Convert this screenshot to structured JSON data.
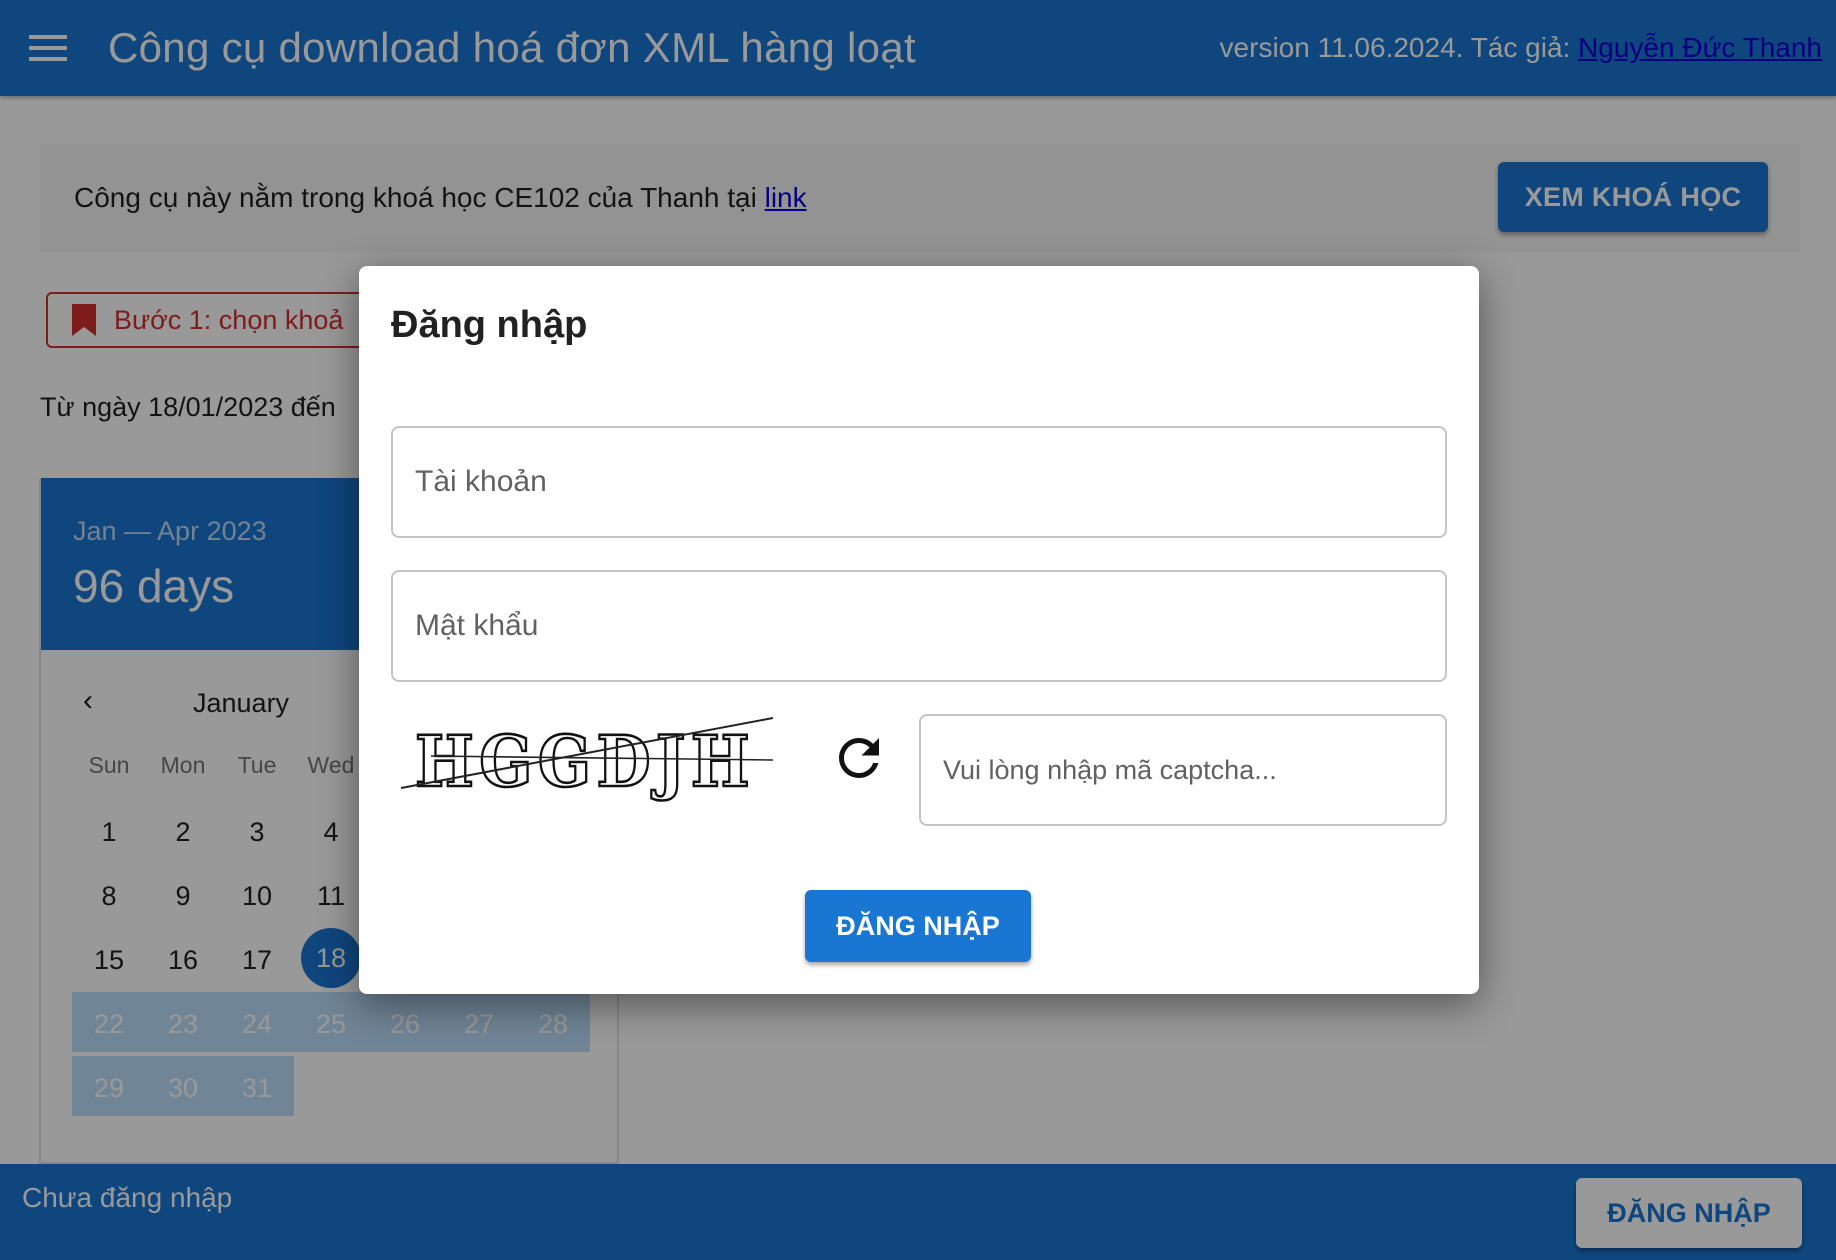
{
  "appbar": {
    "title": "Công cụ download hoá đơn XML hàng loạt",
    "version_text": "version 11.06.2024. Tác giả: ",
    "author": "Nguyễn Đức Thanh"
  },
  "banner": {
    "text": "Công cụ này nằm trong khoá học CE102 của Thanh tại ",
    "link": "link",
    "button": "XEM KHOÁ HỌC"
  },
  "step": {
    "label": "Bước 1: chọn khoả"
  },
  "range_text": "Từ ngày 18/01/2023 đến",
  "calendar": {
    "range": "Jan — Apr 2023",
    "days": "96 days",
    "month": "January",
    "prev_icon": "‹",
    "weekdays": [
      "Sun",
      "Mon",
      "Tue",
      "Wed"
    ],
    "weeks": [
      [
        "1",
        "2",
        "3",
        "4"
      ],
      [
        "8",
        "9",
        "10",
        "11"
      ],
      [
        "15",
        "16",
        "17",
        "18"
      ],
      [
        "22",
        "23",
        "24",
        "25",
        "26",
        "27",
        "28"
      ],
      [
        "29",
        "30",
        "31"
      ]
    ],
    "selected_day": "18"
  },
  "dialog": {
    "title": "Đăng nhập",
    "account_placeholder": "Tài khoản",
    "password_placeholder": "Mật khẩu",
    "captcha_text": "HGGDJH",
    "captcha_placeholder": "Vui lòng nhập mã captcha...",
    "login_button": "ĐĂNG NHẬP"
  },
  "footer": {
    "status": "Chưa đăng nhập",
    "login_button": "ĐĂNG NHẬP"
  },
  "colors": {
    "primary": "#1976d2",
    "error": "#d32f2f",
    "link": "#0b00d6"
  }
}
